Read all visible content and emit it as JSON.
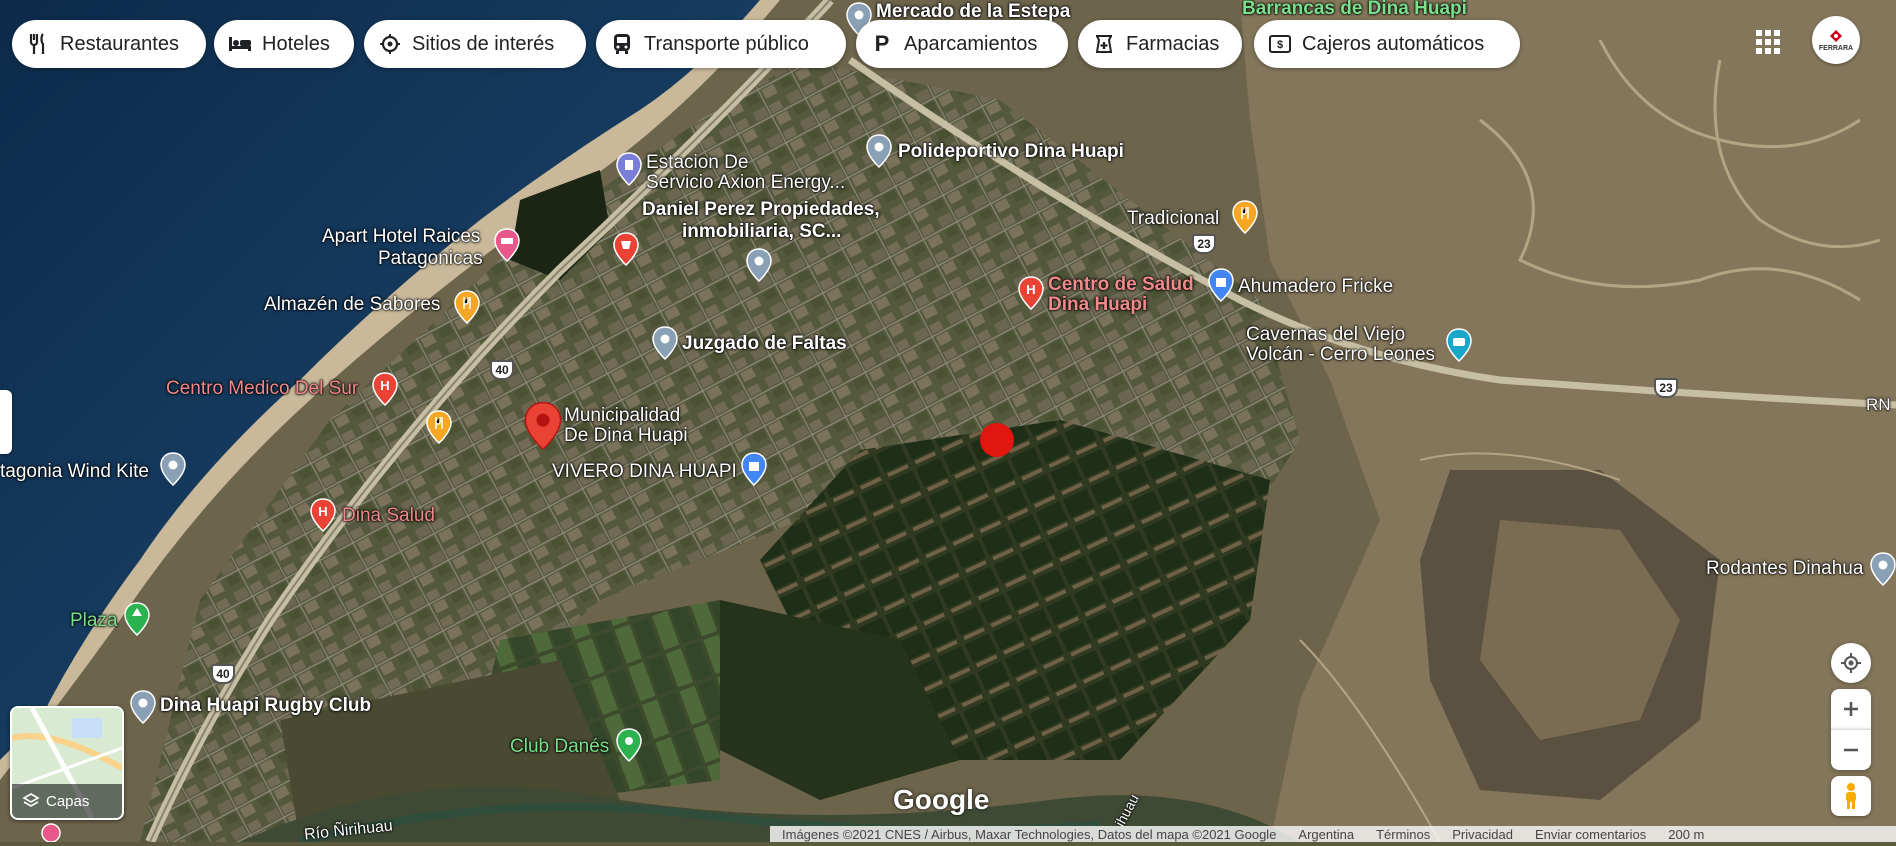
{
  "chips": [
    {
      "label": "Restaurantes",
      "icon": "fork-knife-icon"
    },
    {
      "label": "Hoteles",
      "icon": "bed-icon"
    },
    {
      "label": "Sitios de interés",
      "icon": "landmark-icon"
    },
    {
      "label": "Transporte público",
      "icon": "bus-icon"
    },
    {
      "label": "Aparcamientos",
      "icon": "parking-icon"
    },
    {
      "label": "Farmacias",
      "icon": "pharmacy-icon"
    },
    {
      "label": "Cajeros automáticos",
      "icon": "atm-icon"
    }
  ],
  "places": {
    "mercado": "Mercado de la Estepa",
    "barrancas": "Barrancas de Dina Huapi",
    "polideportivo": "Polideportivo Dina Huapi",
    "estacion_1": "Estacion De",
    "estacion_2": "Servicio Axion Energy...",
    "daniel_1": "Daniel Perez Propiedades,",
    "daniel_2": "inmobiliaria, SC...",
    "apart_1": "Apart Hotel Raices",
    "apart_2": "Patagonicas",
    "tradicional": "Tradicional",
    "salud_1": "Centro de Salud",
    "salud_2": "Dina Huapi",
    "ahumadero": "Ahumadero Fricke",
    "almazen": "Almazén de Sabores",
    "cavernas_1": "Cavernas del Viejo",
    "cavernas_2": "Volcán - Cerro Leones",
    "juzgado": "Juzgado de Faltas",
    "centro_medico": "Centro Medico Del Sur",
    "muni_1": "Municipalidad",
    "muni_2": "De Dina Huapi",
    "vivero": "VIVERO DINA HUAPI",
    "kite": "tagonia Wind Kite",
    "dina_salud": "Dina Salud",
    "rodantes": "Rodantes Dinahua",
    "plaza": "Plaza",
    "rugby": "Dina Huapi Rugby Club",
    "danes": "Club Danés",
    "rio": "Río Ñirihuau",
    "rio2": "ihuau",
    "rn": "RN"
  },
  "roads": {
    "r40a": "40",
    "r40b": "40",
    "r23a": "23",
    "r23b": "23"
  },
  "account": {
    "label": "FERRARA"
  },
  "layers": {
    "label": "Capas"
  },
  "brand": {
    "logo": "Google"
  },
  "footer": {
    "attribution": "Imágenes ©2021 CNES / Airbus, Maxar Technologies, Datos del mapa ©2021 Google",
    "country": "Argentina",
    "terms": "Términos",
    "privacy": "Privacidad",
    "feedback": "Enviar comentarios",
    "scale": "200 m"
  },
  "colors": {
    "pin_red": "#ea4335",
    "pin_blue": "#7aa0d6",
    "pin_gray": "#8aa0b5",
    "pin_orange": "#f5a623",
    "pin_pink": "#e8588b",
    "pin_teal": "#1aa6c9",
    "pin_green": "#2bb34f"
  }
}
